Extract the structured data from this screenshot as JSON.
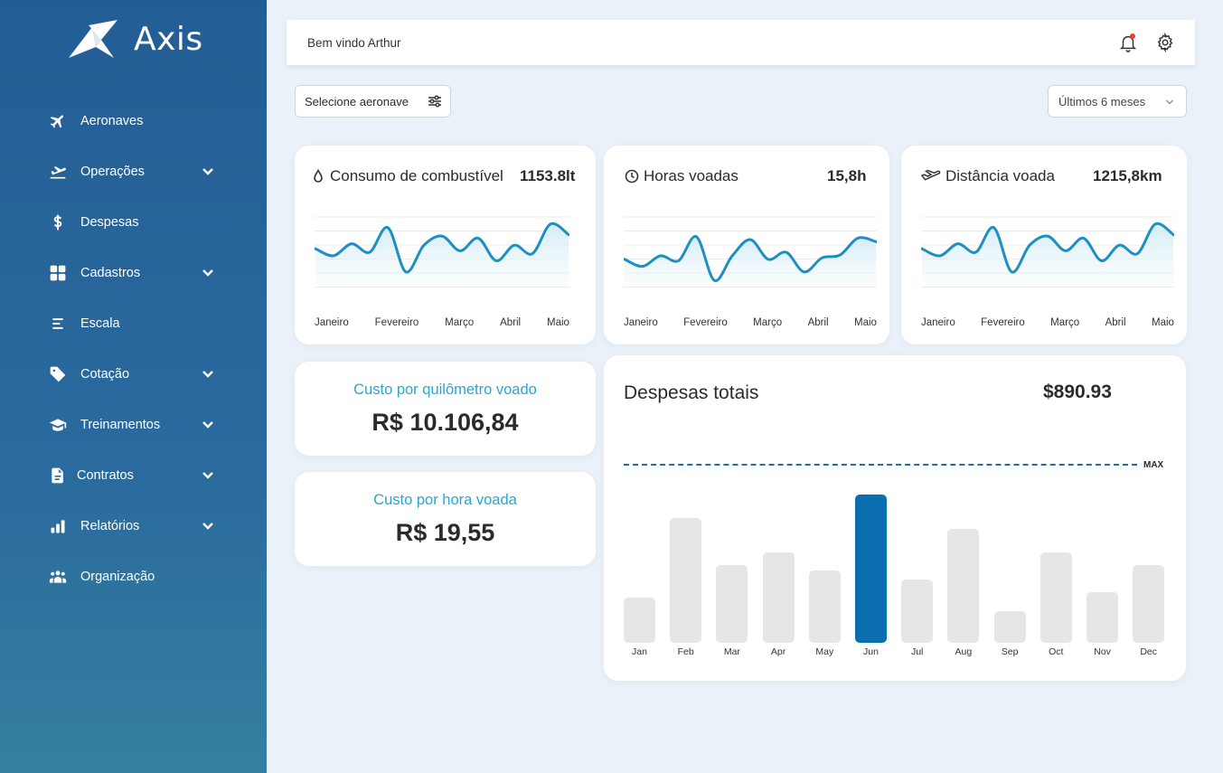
{
  "app": {
    "name": "Axis"
  },
  "sidebar": {
    "items": [
      {
        "label": "Aeronaves",
        "icon": "plane-icon",
        "has_submenu": false
      },
      {
        "label": "Operações",
        "icon": "flight-ops-icon",
        "has_submenu": true
      },
      {
        "label": "Despesas",
        "icon": "dollar-icon",
        "has_submenu": false
      },
      {
        "label": "Cadastros",
        "icon": "grid-icon",
        "has_submenu": true
      },
      {
        "label": "Escala",
        "icon": "list-icon",
        "has_submenu": false
      },
      {
        "label": "Cotação",
        "icon": "tag-icon",
        "has_submenu": true
      },
      {
        "label": "Treinamentos",
        "icon": "graduation-cap-icon",
        "has_submenu": true
      },
      {
        "label": "Contratos",
        "icon": "document-icon",
        "has_submenu": true
      },
      {
        "label": "Relatórios",
        "icon": "bar-chart-icon",
        "has_submenu": true
      },
      {
        "label": "Organização",
        "icon": "users-icon",
        "has_submenu": false
      }
    ]
  },
  "header": {
    "welcome": "Bem vindo Arthur"
  },
  "filters": {
    "aircraft_label": "Selecione aeronave",
    "period_label": "Últimos 6 meses"
  },
  "metrics": [
    {
      "title": "Consumo de combustível",
      "value": "1153.8lt",
      "icon": "drop-icon"
    },
    {
      "title": "Horas voadas",
      "value": "15,8h",
      "icon": "clock-icon"
    },
    {
      "title": "Distância voada",
      "value": "1215,8km",
      "icon": "plane-icon"
    }
  ],
  "metric_months": [
    "Janeiro",
    "Fevereiro",
    "Março",
    "Abril",
    "Maio"
  ],
  "costs": {
    "per_km_title": "Custo por quilômetro voado",
    "per_km_value": "R$ 10.106,84",
    "per_hour_title": "Custo por hora voada",
    "per_hour_value": "R$ 19,55"
  },
  "expenses": {
    "title": "Despesas totais",
    "total": "$890.93",
    "max_label": "MAX"
  },
  "colors": {
    "accent": "#0b6faf",
    "line": "#1e8fc0",
    "sidebar": "#235d95",
    "cost_title": "#2aa6cf"
  },
  "chart_data": [
    {
      "type": "line",
      "x": [
        "Janeiro",
        "Fevereiro",
        "Março",
        "Abril",
        "Maio"
      ],
      "series": [
        {
          "values": [
            55,
            45,
            62,
            50,
            85,
            22,
            60,
            73,
            52,
            70,
            38,
            60,
            48,
            90,
            75
          ]
        }
      ]
    },
    {
      "type": "line",
      "x": [
        "Janeiro",
        "Fevereiro",
        "Março",
        "Abril",
        "Maio"
      ],
      "series": [
        {
          "values": [
            40,
            30,
            45,
            38,
            72,
            10,
            45,
            68,
            40,
            50,
            22,
            42,
            46,
            70,
            65
          ]
        }
      ]
    },
    {
      "type": "line",
      "x": [
        "Janeiro",
        "Fevereiro",
        "Março",
        "Abril",
        "Maio"
      ],
      "series": [
        {
          "values": [
            55,
            45,
            62,
            50,
            85,
            22,
            60,
            73,
            52,
            70,
            38,
            60,
            48,
            90,
            75
          ]
        }
      ]
    },
    {
      "type": "bar",
      "title": "Despesas totais",
      "categories": [
        "Jan",
        "Feb",
        "Mar",
        "Apr",
        "May",
        "Jun",
        "Jul",
        "Aug",
        "Sep",
        "Oct",
        "Nov",
        "Dec"
      ],
      "values": [
        30,
        83,
        52,
        60,
        48,
        99,
        42,
        76,
        21,
        60,
        34,
        52
      ],
      "highlight": "Jun",
      "ylim": [
        0,
        100
      ]
    }
  ]
}
